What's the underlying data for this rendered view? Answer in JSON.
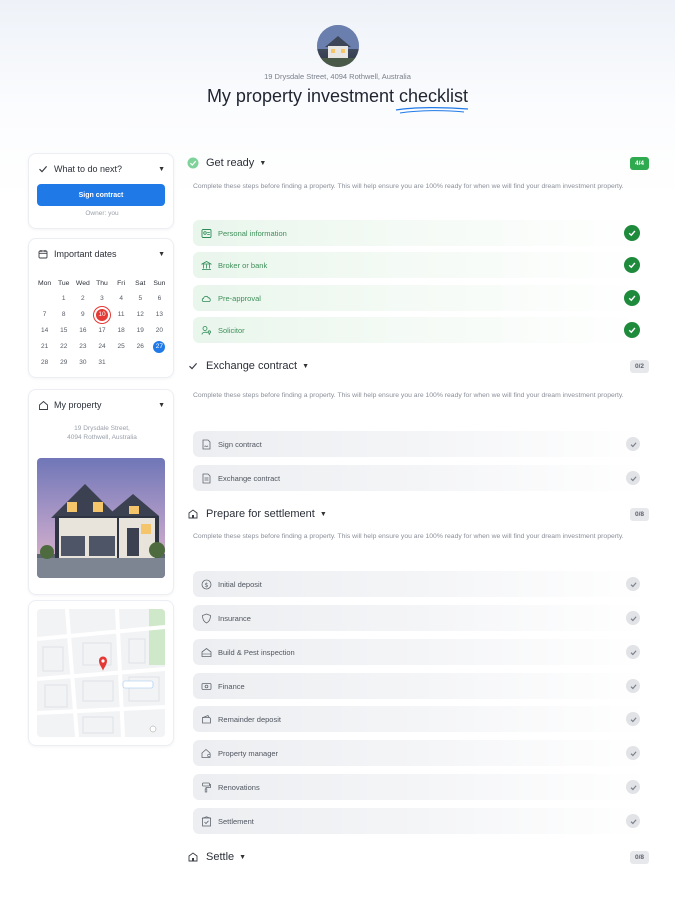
{
  "header": {
    "address": "19 Drysdale Street, 4094 Rothwell, Australia",
    "title_prefix": "My property investment ",
    "title_highlight": "checklist"
  },
  "next_card": {
    "title": "What to do next?",
    "button_label": "Sign contract",
    "owner_note": "Owner: you"
  },
  "dates_card": {
    "title": "Important dates",
    "weekdays": [
      "Mon",
      "Tue",
      "Wed",
      "Thu",
      "Fri",
      "Sat",
      "Sun"
    ],
    "days": [
      "",
      "1",
      "2",
      "3",
      "4",
      "5",
      "6",
      "7",
      "8",
      "9",
      "10",
      "11",
      "12",
      "13",
      "14",
      "15",
      "16",
      "17",
      "18",
      "19",
      "20",
      "21",
      "22",
      "23",
      "24",
      "25",
      "26",
      "27",
      "28",
      "29",
      "30",
      "31"
    ],
    "highlight_red": "10",
    "highlight_blue": "27"
  },
  "property_card": {
    "title": "My property",
    "address_line1": "19 Drysdale Street,",
    "address_line2": "4094 Rothwell, Australia"
  },
  "sections": {
    "get_ready": {
      "title": "Get ready",
      "badge": "4/4",
      "description": "Complete these steps before finding a property. This will help ensure you are 100% ready for when we will find your dream investment property.",
      "items": [
        "Personal information",
        "Broker or bank",
        "Pre-approval",
        "Solicitor"
      ]
    },
    "exchange": {
      "title": "Exchange contract",
      "badge": "0/2",
      "description": "Complete these steps before finding a property. This will help ensure you are 100% ready for when we will find your dream investment property.",
      "items": [
        "Sign contract",
        "Exchange contract"
      ]
    },
    "settlement": {
      "title": "Prepare for settlement",
      "badge": "0/8",
      "description": "Complete these steps before finding a property. This will help ensure you are 100% ready for when we will find your dream investment property.",
      "items": [
        "Initial deposit",
        "Insurance",
        "Build & Pest inspection",
        "Finance",
        "Remainder deposit",
        "Property manager",
        "Renovations",
        "Settlement"
      ]
    },
    "settle": {
      "title": "Settle",
      "badge": "0/8"
    }
  },
  "colors": {
    "accent_blue": "#1f7ae8",
    "done_green": "#1e8a3b",
    "badge_green": "#2faa4e",
    "highlight_red": "#e53935"
  }
}
